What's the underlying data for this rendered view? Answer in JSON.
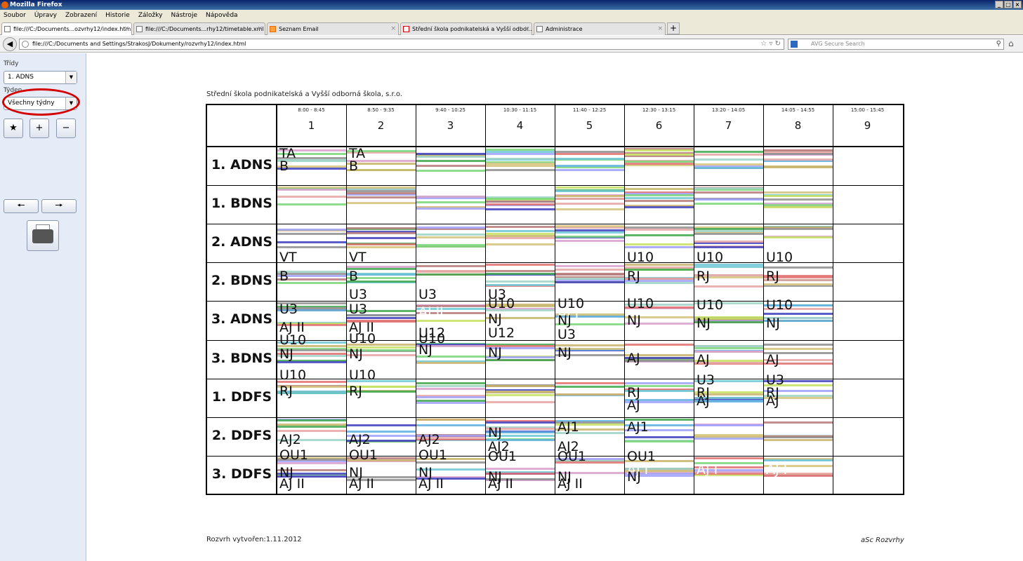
{
  "window": {
    "title": "Mozilla Firefox",
    "controls": [
      "_",
      "□",
      "×"
    ]
  },
  "menu": [
    "Soubor",
    "Úpravy",
    "Zobrazení",
    "Historie",
    "Záložky",
    "Nástroje",
    "Nápověda"
  ],
  "tabs": [
    {
      "label": "file:///C:/Documents...ozvrhy12/index.html",
      "close": "×"
    },
    {
      "label": "file:///C:/Documents...rhy12/timetable.xml",
      "close": "×"
    },
    {
      "label": "Seznam Email",
      "close": "×"
    },
    {
      "label": "Střední škola podnikatelská a Vyšší odbor...",
      "close": "×"
    },
    {
      "label": "Administrace",
      "close": "×"
    }
  ],
  "new_tab": "+",
  "url": "file:///C:/Documents and Settings/StrakosJ/Dokumenty/rozvrhy12/index.html",
  "search_placeholder": "AVG Secure Search",
  "sidebar": {
    "classes_label": "Třídy",
    "class_value": "1. ADNS",
    "week_label": "Týden",
    "week_value": "Všechny týdny"
  },
  "school_name": "Střední škola podnikatelská a Vyšší odborná škola, s.r.o.",
  "periods": [
    {
      "num": "1",
      "time": "8:00 - 8:45"
    },
    {
      "num": "2",
      "time": "8:50 - 9:35"
    },
    {
      "num": "3",
      "time": "9:40 - 10:25"
    },
    {
      "num": "4",
      "time": "10:30 - 11:15"
    },
    {
      "num": "5",
      "time": "11:40 - 12:25"
    },
    {
      "num": "6",
      "time": "12:30 - 13:15"
    },
    {
      "num": "7",
      "time": "13:20 - 14:05"
    },
    {
      "num": "8",
      "time": "14:05 - 14:55"
    },
    {
      "num": "9",
      "time": "15:00 - 15:45"
    }
  ],
  "classes": [
    "1. ADNS",
    "1. BDNS",
    "2. ADNS",
    "2. BDNS",
    "3. ADNS",
    "3. BDNS",
    "1. DDFS",
    "2. DDFS",
    "3. DDFS"
  ],
  "overlays": [
    {
      "t": "TA",
      "r": 0,
      "c": 0,
      "y": 0
    },
    {
      "t": "B",
      "r": 0,
      "c": 0,
      "y": 18
    },
    {
      "t": "TA",
      "r": 0,
      "c": 1,
      "y": 0
    },
    {
      "t": "B",
      "r": 0,
      "c": 1,
      "y": 18
    },
    {
      "t": "VT",
      "r": 2,
      "c": 0,
      "y": 38
    },
    {
      "t": "VT",
      "r": 2,
      "c": 1,
      "y": 38
    },
    {
      "t": "U10",
      "r": 2,
      "c": 5,
      "y": 38
    },
    {
      "t": "U10",
      "r": 2,
      "c": 6,
      "y": 38
    },
    {
      "t": "U10",
      "r": 2,
      "c": 7,
      "y": 38
    },
    {
      "t": "B",
      "r": 3,
      "c": 0,
      "y": 10
    },
    {
      "t": "B",
      "r": 3,
      "c": 1,
      "y": 10
    },
    {
      "t": "RJ",
      "r": 3,
      "c": 5,
      "y": 10
    },
    {
      "t": "RJ",
      "r": 3,
      "c": 6,
      "y": 10
    },
    {
      "t": "RJ",
      "r": 3,
      "c": 7,
      "y": 10
    },
    {
      "t": "U3",
      "r": 3,
      "c": 1,
      "y": 36
    },
    {
      "t": "U3",
      "r": 3,
      "c": 2,
      "y": 36
    },
    {
      "t": "U3",
      "r": 3,
      "c": 3,
      "y": 36
    },
    {
      "t": "U3",
      "r": 4,
      "c": 0,
      "y": 2
    },
    {
      "t": "AJ II",
      "r": 4,
      "c": 0,
      "y": 28
    },
    {
      "t": "U10",
      "r": 4,
      "c": 0,
      "y": 46
    },
    {
      "t": "U3",
      "r": 4,
      "c": 1,
      "y": 2
    },
    {
      "t": "AJ II",
      "r": 4,
      "c": 1,
      "y": 28
    },
    {
      "t": "U10",
      "r": 4,
      "c": 1,
      "y": 44
    },
    {
      "t": "AJ II",
      "r": 4,
      "c": 2,
      "y": 6,
      "w": true
    },
    {
      "t": "U12",
      "r": 4,
      "c": 2,
      "y": 36
    },
    {
      "t": "U10",
      "r": 4,
      "c": 2,
      "y": 44
    },
    {
      "t": "U10",
      "r": 4,
      "c": 3,
      "y": -6
    },
    {
      "t": "NJ",
      "r": 4,
      "c": 3,
      "y": 16
    },
    {
      "t": "U12",
      "r": 4,
      "c": 3,
      "y": 36
    },
    {
      "t": "U10",
      "r": 4,
      "c": 4,
      "y": -6
    },
    {
      "t": "AJ I",
      "r": 4,
      "c": 4,
      "y": 8,
      "w": true
    },
    {
      "t": "NJ",
      "r": 4,
      "c": 4,
      "y": 18
    },
    {
      "t": "U3",
      "r": 4,
      "c": 4,
      "y": 38
    },
    {
      "t": "U10",
      "r": 4,
      "c": 5,
      "y": -6
    },
    {
      "t": "NJ",
      "r": 4,
      "c": 5,
      "y": 18
    },
    {
      "t": "U10",
      "r": 4,
      "c": 6,
      "y": -4
    },
    {
      "t": "NJ",
      "r": 4,
      "c": 6,
      "y": 22
    },
    {
      "t": "U10",
      "r": 4,
      "c": 7,
      "y": -4
    },
    {
      "t": "NJ",
      "r": 4,
      "c": 7,
      "y": 22
    },
    {
      "t": "NJ",
      "r": 5,
      "c": 0,
      "y": 10
    },
    {
      "t": "U10",
      "r": 5,
      "c": 0,
      "y": 40
    },
    {
      "t": "NJ",
      "r": 5,
      "c": 1,
      "y": 10
    },
    {
      "t": "U10",
      "r": 5,
      "c": 1,
      "y": 40
    },
    {
      "t": "NJ",
      "r": 5,
      "c": 2,
      "y": 4
    },
    {
      "t": "NJ",
      "r": 5,
      "c": 3,
      "y": 8
    },
    {
      "t": "NJ",
      "r": 5,
      "c": 4,
      "y": 8
    },
    {
      "t": "AJ",
      "r": 5,
      "c": 5,
      "y": 16
    },
    {
      "t": "AJ",
      "r": 5,
      "c": 6,
      "y": 18
    },
    {
      "t": "AJ",
      "r": 5,
      "c": 7,
      "y": 18
    },
    {
      "t": "RJ",
      "r": 6,
      "c": 0,
      "y": 8
    },
    {
      "t": "RJ",
      "r": 6,
      "c": 1,
      "y": 8
    },
    {
      "t": "RJ",
      "r": 6,
      "c": 5,
      "y": 10
    },
    {
      "t": "AJ",
      "r": 6,
      "c": 5,
      "y": 28
    },
    {
      "t": "U3",
      "r": 6,
      "c": 6,
      "y": -8
    },
    {
      "t": "RJ",
      "r": 6,
      "c": 6,
      "y": 10
    },
    {
      "t": "AJ",
      "r": 6,
      "c": 6,
      "y": 22
    },
    {
      "t": "U3",
      "r": 6,
      "c": 7,
      "y": -8
    },
    {
      "t": "RJ",
      "r": 6,
      "c": 7,
      "y": 10
    },
    {
      "t": "AJ",
      "r": 6,
      "c": 7,
      "y": 22
    },
    {
      "t": "AJ1",
      "r": 7,
      "c": 4,
      "y": 4
    },
    {
      "t": "AJ1",
      "r": 7,
      "c": 5,
      "y": 4
    },
    {
      "t": "AJ2",
      "r": 7,
      "c": 0,
      "y": 22
    },
    {
      "t": "AJ2",
      "r": 7,
      "c": 1,
      "y": 22
    },
    {
      "t": "AJ2",
      "r": 7,
      "c": 2,
      "y": 22
    },
    {
      "t": "NJ",
      "r": 7,
      "c": 3,
      "y": 12
    },
    {
      "t": "AJ2",
      "r": 7,
      "c": 3,
      "y": 32
    },
    {
      "t": "AJ2",
      "r": 7,
      "c": 4,
      "y": 32
    },
    {
      "t": "OU1",
      "r": 7,
      "c": 0,
      "y": 44
    },
    {
      "t": "OU1",
      "r": 7,
      "c": 1,
      "y": 44
    },
    {
      "t": "OU1",
      "r": 7,
      "c": 2,
      "y": 44
    },
    {
      "t": "OU1",
      "r": 7,
      "c": 3,
      "y": 46
    },
    {
      "t": "OU1",
      "r": 7,
      "c": 4,
      "y": 46
    },
    {
      "t": "OU1",
      "r": 7,
      "c": 5,
      "y": 46
    },
    {
      "t": "NJ",
      "r": 8,
      "c": 0,
      "y": 14
    },
    {
      "t": "AJ II",
      "r": 8,
      "c": 0,
      "y": 30
    },
    {
      "t": "NJ",
      "r": 8,
      "c": 1,
      "y": 14
    },
    {
      "t": "AJ II",
      "r": 8,
      "c": 1,
      "y": 30
    },
    {
      "t": "NJ",
      "r": 8,
      "c": 2,
      "y": 14
    },
    {
      "t": "AJ II",
      "r": 8,
      "c": 2,
      "y": 30
    },
    {
      "t": "NJ",
      "r": 8,
      "c": 3,
      "y": 20
    },
    {
      "t": "AJ II",
      "r": 8,
      "c": 3,
      "y": 30
    },
    {
      "t": "NJ",
      "r": 8,
      "c": 4,
      "y": 20
    },
    {
      "t": "AJ II",
      "r": 8,
      "c": 4,
      "y": 30
    },
    {
      "t": "AJ I",
      "r": 8,
      "c": 5,
      "y": 10,
      "w": true
    },
    {
      "t": "NJ",
      "r": 8,
      "c": 5,
      "y": 20
    },
    {
      "t": "AJ I",
      "r": 8,
      "c": 6,
      "y": 10,
      "w": true
    },
    {
      "t": "AJ I",
      "r": 8,
      "c": 7,
      "y": 10,
      "w": true
    }
  ],
  "created": "Rozvrh vytvořen:1.11.2012",
  "brand": "aSc Rozvrhy"
}
